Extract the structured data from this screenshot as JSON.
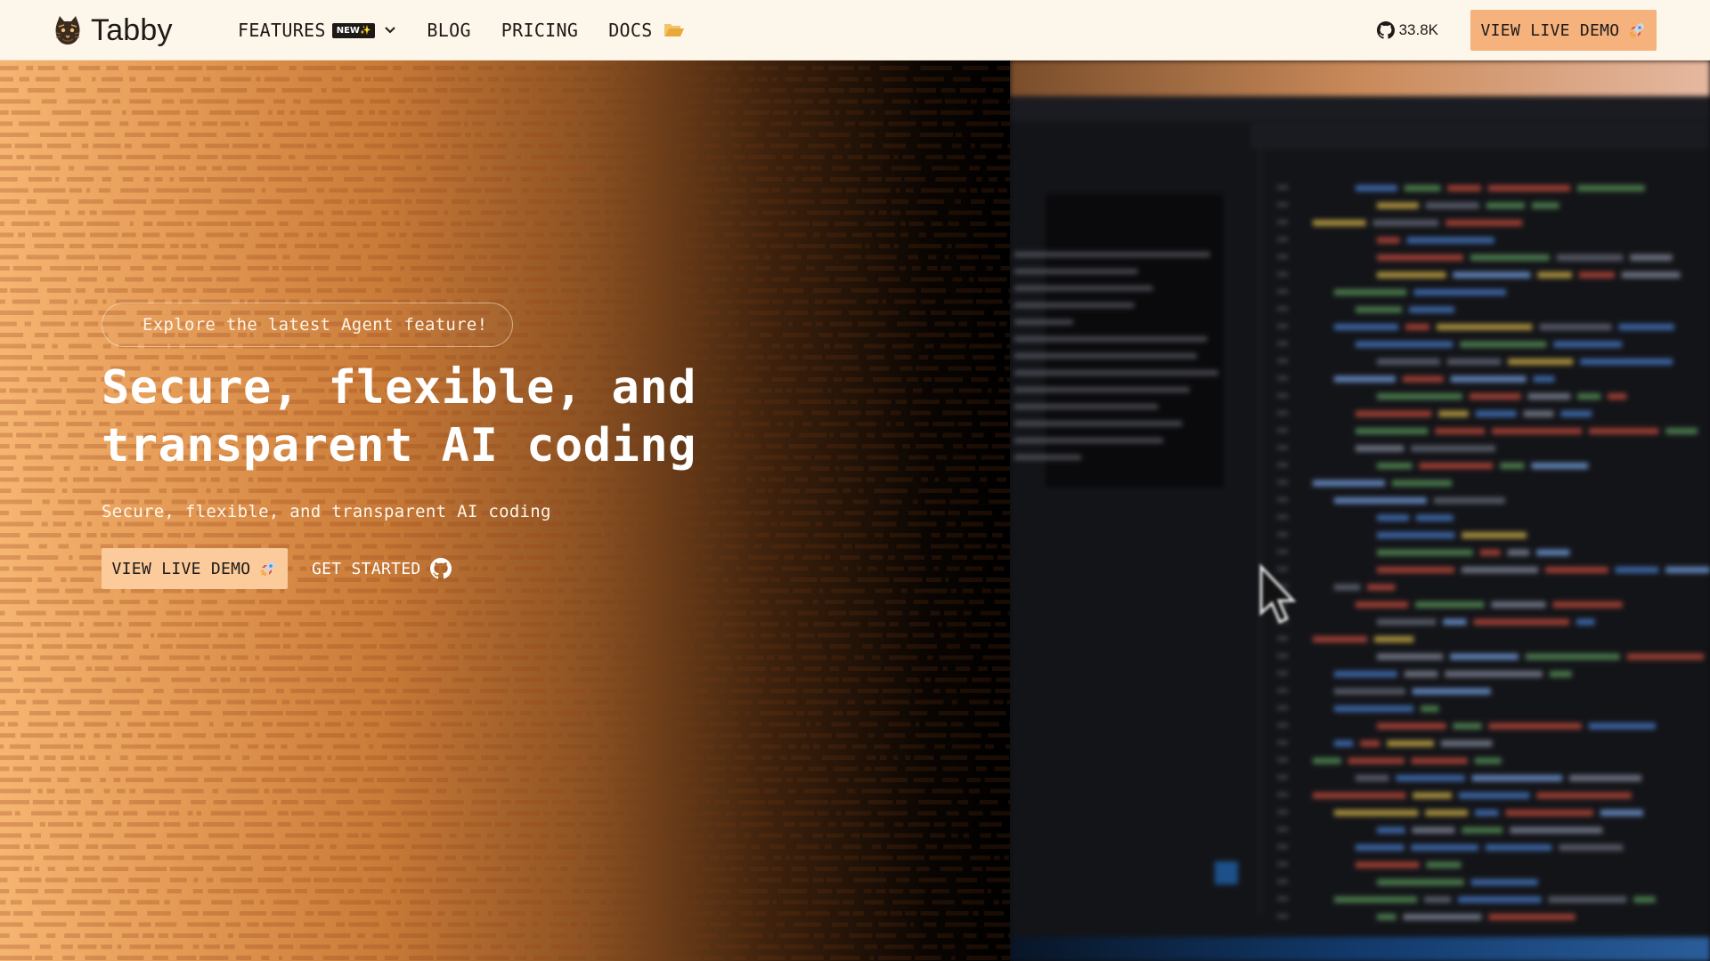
{
  "nav": {
    "brand_name": "Tabby",
    "features_label": "FEATURES",
    "features_badge": "NEW✨",
    "blog_label": "BLOG",
    "pricing_label": "PRICING",
    "docs_label": "DOCS",
    "github_stars": "33.8K",
    "demo_button_label": "VIEW LIVE DEMO"
  },
  "hero": {
    "announcement": "Explore the latest Agent feature!",
    "headline": "Secure, flexible, and transparent AI coding",
    "subheadline": "Secure, flexible, and transparent AI coding",
    "primary_button_label": "VIEW LIVE DEMO",
    "secondary_button_label": "GET STARTED"
  },
  "icons": {
    "logo": "tabby-cat-logo-icon",
    "features_chevron": "chevron-down-icon",
    "docs": "folder-icon",
    "github": "github-icon",
    "rocket": "rocket-icon",
    "cursor": "mouse-pointer-icon"
  },
  "colors": {
    "nav_bg": "#fdf6ea",
    "accent_button": "#f5b27d",
    "hero_gradient_start": "#f6b572",
    "hero_gradient_end": "#000000"
  }
}
